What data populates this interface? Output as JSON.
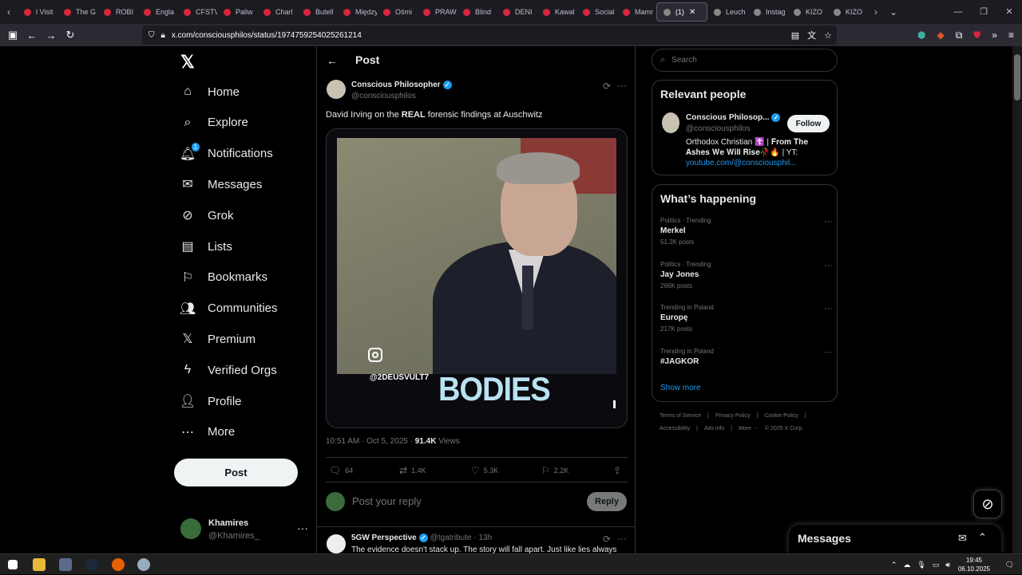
{
  "browser": {
    "tabs": [
      "l Visit",
      "The G",
      "ROBI",
      "Engla",
      "CFSTV",
      "Paliw",
      "Charl",
      "Butell",
      "Między",
      "Ośmi",
      "PRAW",
      "Blind",
      "DENI",
      "Kawal",
      "Social",
      "Mamr",
      "(1)",
      "Leuch",
      "Instag",
      "KIZO",
      "KIZO"
    ],
    "active_tab_label": "(1)",
    "url": "x.com/consciousphilos/status/1974759254025261214"
  },
  "leftnav": {
    "items": [
      {
        "label": "Home",
        "icon": "home-icon"
      },
      {
        "label": "Explore",
        "icon": "search-icon"
      },
      {
        "label": "Notifications",
        "icon": "bell-icon",
        "badge": "1"
      },
      {
        "label": "Messages",
        "icon": "envelope-icon"
      },
      {
        "label": "Grok",
        "icon": "grok-icon"
      },
      {
        "label": "Lists",
        "icon": "list-icon"
      },
      {
        "label": "Bookmarks",
        "icon": "bookmark-icon"
      },
      {
        "label": "Communities",
        "icon": "people-icon"
      },
      {
        "label": "Premium",
        "icon": "x-icon"
      },
      {
        "label": "Verified Orgs",
        "icon": "bolt-icon"
      },
      {
        "label": "Profile",
        "icon": "person-icon"
      },
      {
        "label": "More",
        "icon": "more-circle-icon"
      }
    ],
    "post_button": "Post",
    "account": {
      "name": "Khamires",
      "handle": "@Khamires_"
    }
  },
  "main": {
    "title": "Post",
    "post": {
      "author": "Conscious Philosopher",
      "handle": "@consciousphilos",
      "text_before": "David Irving on the ",
      "text_bold": "REAL",
      "text_after": " forensic findings at Auschwitz",
      "video_watermark": "@2DEUSVULT7",
      "video_caption": "BODIES",
      "time": "10:51 AM · Oct 5, 2025 · ",
      "views": "91.4K",
      "views_label": " Views",
      "replies": "64",
      "reposts": "1.4K",
      "likes": "5.3K",
      "bookmarks": "2.2K"
    },
    "reply": {
      "placeholder": "Post your reply",
      "button": "Reply"
    },
    "next_post": {
      "author": "5GW Perspective",
      "handle": "@tgatribute · 13h",
      "text": "The evidence doesn't stack up. The story will fall apart. Just like lies always"
    }
  },
  "right": {
    "search_placeholder": "Search",
    "relevant": {
      "title": "Relevant people",
      "name": "Conscious Philosop...",
      "handle": "@consciousphilos",
      "follow": "Follow",
      "bio_line1": "Orthodox Christian ☦️ | 𝐅𝐫𝐨𝐦 𝐓𝐡𝐞",
      "bio_line2": "𝐀𝐬𝐡𝐞𝐬 𝐖𝐞 𝐖𝐢𝐥𝐥 𝐑𝐢𝐬𝐞🥀🔥 | YT:",
      "link": "youtube.com/@consciousphil..."
    },
    "happening": {
      "title": "What’s happening",
      "trends": [
        {
          "category": "Politics · Trending",
          "title": "Merkel",
          "count": "51.2K posts"
        },
        {
          "category": "Politics · Trending",
          "title": "Jay Jones",
          "count": "266K posts"
        },
        {
          "category": "Trending in Poland",
          "title": "Europę",
          "count": "217K posts"
        },
        {
          "category": "Trending in Poland",
          "title": "#JAGKOR",
          "count": ""
        }
      ],
      "show_more": "Show more"
    },
    "footer": {
      "line1": [
        "Terms of Service",
        "|",
        "Privacy Policy",
        "|",
        "Cookie Policy",
        "|"
      ],
      "line2": [
        "Accessibility",
        "|",
        "Ads info",
        "|",
        "More ···",
        "© 2025 X Corp."
      ]
    }
  },
  "messages_drawer": {
    "title": "Messages"
  },
  "taskbar": {
    "time": "19:45",
    "date": "06.10.2025"
  },
  "colors": {
    "accent": "#1d9bf0",
    "bg": "#000000",
    "border": "#2f3336",
    "muted": "#71767b"
  }
}
